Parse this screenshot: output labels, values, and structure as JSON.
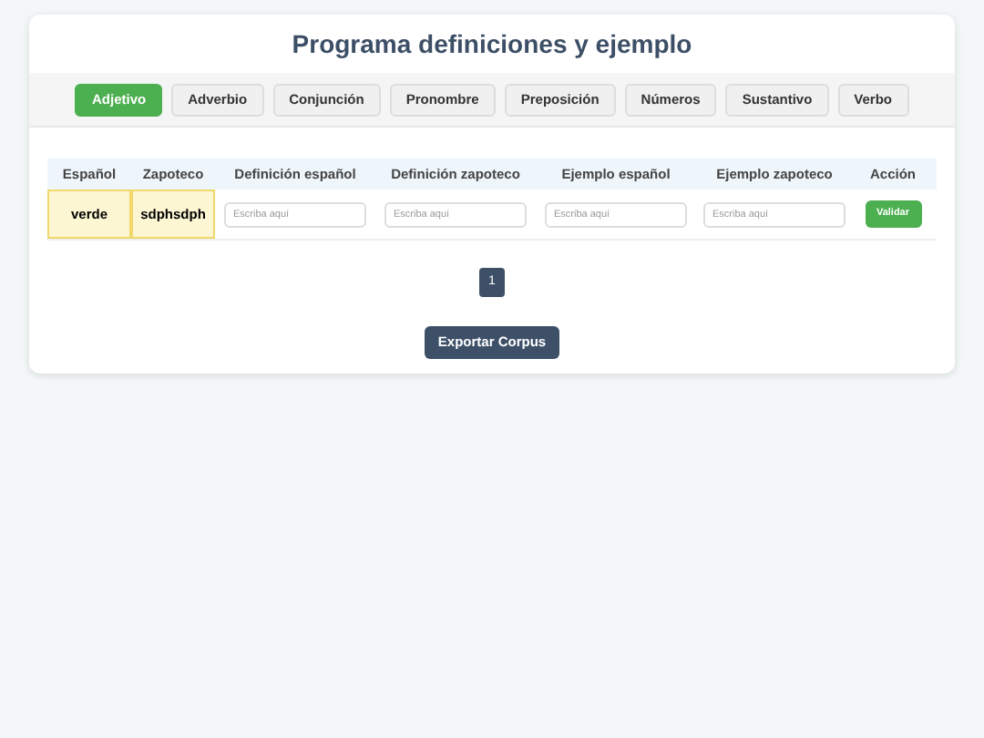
{
  "title": "Programa definiciones y ejemplo",
  "tabs": [
    {
      "label": "Adjetivo",
      "selected": true
    },
    {
      "label": "Adverbio",
      "selected": false
    },
    {
      "label": "Conjunción",
      "selected": false
    },
    {
      "label": "Pronombre",
      "selected": false
    },
    {
      "label": "Preposición",
      "selected": false
    },
    {
      "label": "Números",
      "selected": false
    },
    {
      "label": "Sustantivo",
      "selected": false
    },
    {
      "label": "Verbo",
      "selected": false
    }
  ],
  "table": {
    "columns": [
      "Español",
      "Zapoteco",
      "Definición español",
      "Definición zapoteco",
      "Ejemplo español",
      "Ejemplo zapoteco",
      "Acción"
    ],
    "rows": [
      {
        "espanol": "verde",
        "zapoteco": "sdphsdph",
        "highlighted": true,
        "fields": [
          {
            "placeholder": "Escriba aquí"
          },
          {
            "placeholder": "Escriba aquí"
          },
          {
            "placeholder": "Escriba aquí"
          },
          {
            "placeholder": "Escriba aquí"
          }
        ],
        "action": "Validar"
      }
    ]
  },
  "pagination": [
    {
      "label": "1",
      "selected": true
    }
  ],
  "export_button": "Exportar Corpus"
}
